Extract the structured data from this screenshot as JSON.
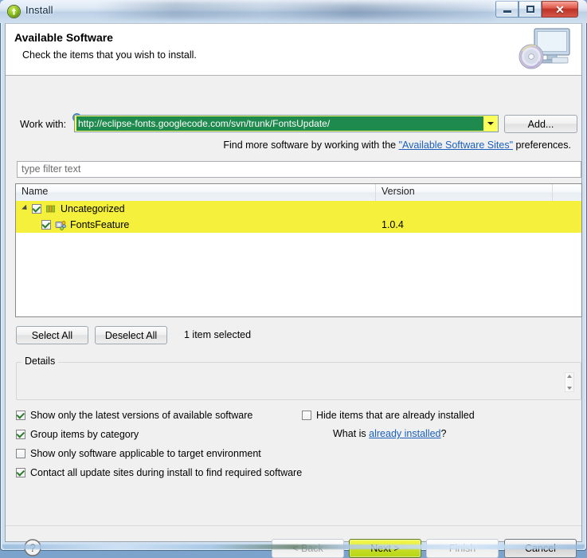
{
  "window": {
    "title": "Install",
    "icon": "eclipse-install-icon",
    "controls": {
      "minimize": "minimize-icon",
      "maximize": "maximize-icon",
      "close": "close-icon"
    }
  },
  "banner": {
    "title": "Available Software",
    "subtitle": "Check the items that you wish to install.",
    "icon": "monitor-disc-icon"
  },
  "workwith": {
    "label": "Work with:",
    "info_icon": "info-icon",
    "value": "http://eclipse-fonts.googlecode.com/svn/trunk/FontsUpdate/",
    "dropdown_icon": "chevron-down-icon",
    "add_label": "Add...",
    "field_bg": "#fdfd5c",
    "selection_bg": "#1f8a4d"
  },
  "hint": {
    "prefix": "Find more software by working with the ",
    "link": "\"Available Software Sites\"",
    "suffix": " preferences."
  },
  "filter": {
    "placeholder": "type filter text",
    "value": ""
  },
  "table": {
    "columns": [
      "Name",
      "Version",
      ""
    ],
    "highlight_color": "#f5f03c",
    "rows": [
      {
        "name": "Uncategorized",
        "version": "",
        "checked": true,
        "expanded": true,
        "level": 0,
        "icon": "category-icon"
      },
      {
        "name": "FontsFeature",
        "version": "1.0.4",
        "checked": true,
        "expanded": null,
        "level": 1,
        "icon": "feature-icon"
      }
    ]
  },
  "selection": {
    "select_all": "Select All",
    "deselect_all": "Deselect All",
    "count_text": "1 item selected"
  },
  "details": {
    "legend": "Details",
    "content": ""
  },
  "options": [
    {
      "label": "Show only the latest versions of available software",
      "checked": true
    },
    {
      "label": "Group items by category",
      "checked": true
    },
    {
      "label": "Show only software applicable to target environment",
      "checked": false
    },
    {
      "label": "Contact all update sites during install to find required software",
      "checked": true
    },
    {
      "label": "Hide items that are already installed",
      "checked": false
    }
  ],
  "whatis": {
    "prefix": "What is ",
    "link": "already installed",
    "suffix": "?"
  },
  "footer": {
    "help_icon": "help-icon",
    "back": "< Back",
    "next": "Next >",
    "finish": "Finish",
    "cancel": "Cancel",
    "next_color": "#c7dd23"
  }
}
